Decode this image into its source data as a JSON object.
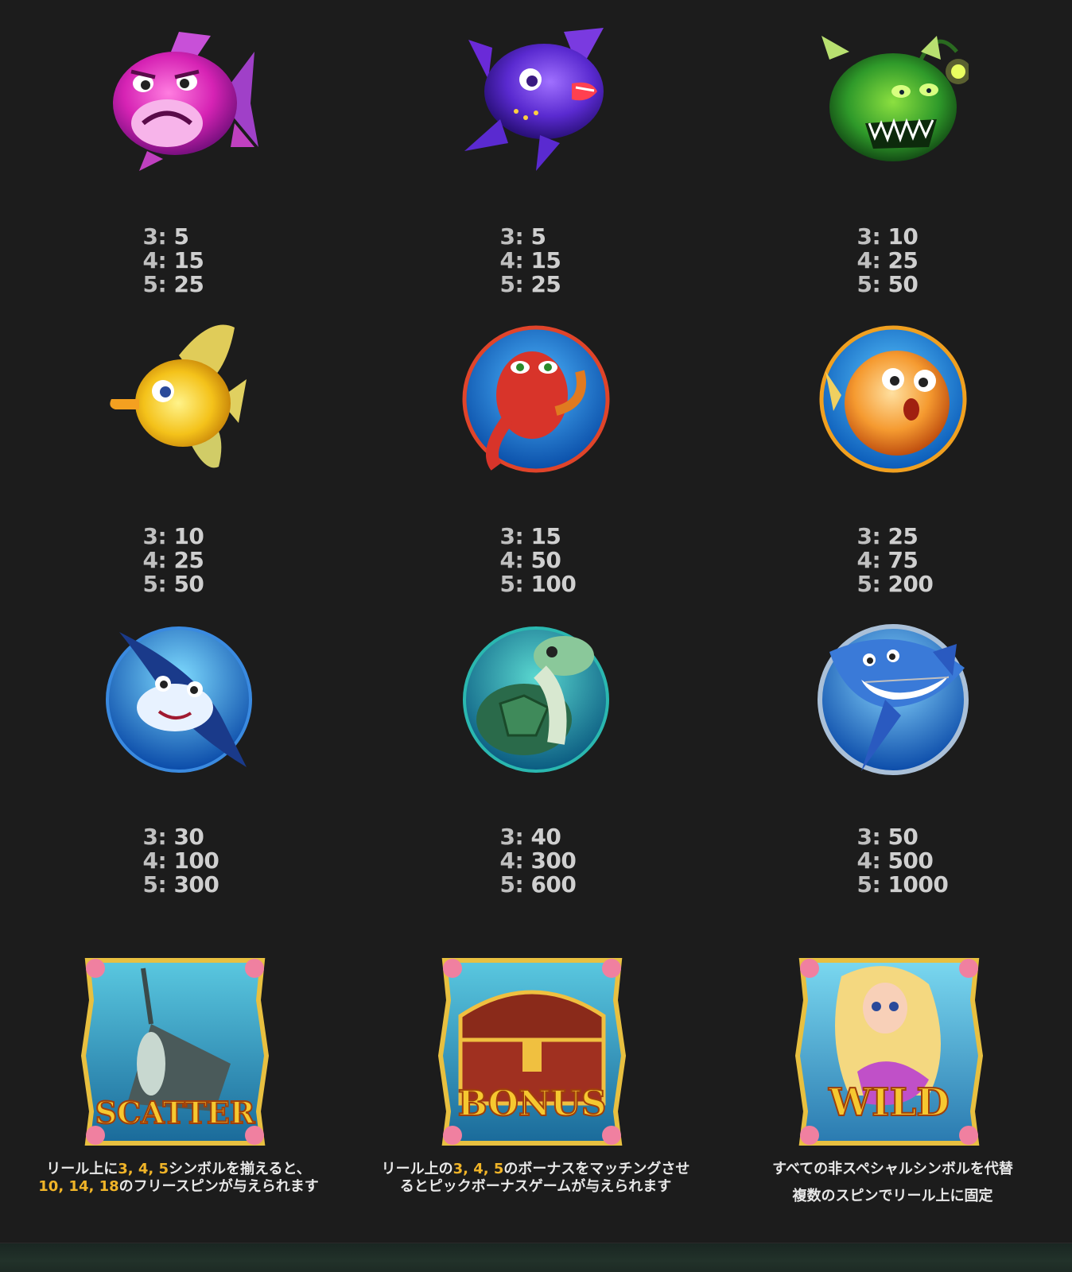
{
  "symbols": [
    {
      "icon": "pink-pufferfish-icon",
      "pays": [
        {
          "count": "3:",
          "value": "5"
        },
        {
          "count": "4:",
          "value": "15"
        },
        {
          "count": "5:",
          "value": "25"
        }
      ]
    },
    {
      "icon": "purple-piranha-icon",
      "pays": [
        {
          "count": "3:",
          "value": "5"
        },
        {
          "count": "4:",
          "value": "15"
        },
        {
          "count": "5:",
          "value": "25"
        }
      ]
    },
    {
      "icon": "green-anglerfish-icon",
      "pays": [
        {
          "count": "3:",
          "value": "10"
        },
        {
          "count": "4:",
          "value": "25"
        },
        {
          "count": "5:",
          "value": "50"
        }
      ]
    },
    {
      "icon": "yellow-tang-fish-icon",
      "pays": [
        {
          "count": "3:",
          "value": "10"
        },
        {
          "count": "4:",
          "value": "25"
        },
        {
          "count": "5:",
          "value": "50"
        }
      ]
    },
    {
      "icon": "red-octopus-icon",
      "pays": [
        {
          "count": "3:",
          "value": "15"
        },
        {
          "count": "4:",
          "value": "50"
        },
        {
          "count": "5:",
          "value": "100"
        }
      ]
    },
    {
      "icon": "orange-blowfish-icon",
      "pays": [
        {
          "count": "3:",
          "value": "25"
        },
        {
          "count": "4:",
          "value": "75"
        },
        {
          "count": "5:",
          "value": "200"
        }
      ]
    },
    {
      "icon": "manta-ray-icon",
      "pays": [
        {
          "count": "3:",
          "value": "30"
        },
        {
          "count": "4:",
          "value": "100"
        },
        {
          "count": "5:",
          "value": "300"
        }
      ]
    },
    {
      "icon": "sea-turtle-icon",
      "pays": [
        {
          "count": "3:",
          "value": "40"
        },
        {
          "count": "4:",
          "value": "300"
        },
        {
          "count": "5:",
          "value": "600"
        }
      ]
    },
    {
      "icon": "shark-icon",
      "pays": [
        {
          "count": "3:",
          "value": "50"
        },
        {
          "count": "4:",
          "value": "500"
        },
        {
          "count": "5:",
          "value": "1000"
        }
      ]
    }
  ],
  "specials": {
    "scatter": {
      "icon": "scatter-shipwreck-icon",
      "logo_text": "SCATTER",
      "desc_parts": [
        "リール上に",
        "3, 4, 5",
        "シンボルを揃えると、",
        "10, 14, 18",
        "のフリースピンが与えられます"
      ]
    },
    "bonus": {
      "icon": "bonus-treasure-chest-icon",
      "logo_text": "BONUS",
      "desc_parts": [
        "リール上の",
        "3, 4, 5",
        "のボーナスをマッチングさせるとピックボーナスゲームが与えられます"
      ]
    },
    "wild": {
      "icon": "wild-mermaid-icon",
      "logo_text": "WILD",
      "desc_line1": "すべての非スペシャルシンボルを代替",
      "desc_line2": "複数のスピンでリール上に固定"
    }
  },
  "colors": {
    "background": "#1c1c1c",
    "payout_text": "#cfcfcf",
    "highlight": "#f0b428",
    "desc_text": "#e8e8e8"
  }
}
